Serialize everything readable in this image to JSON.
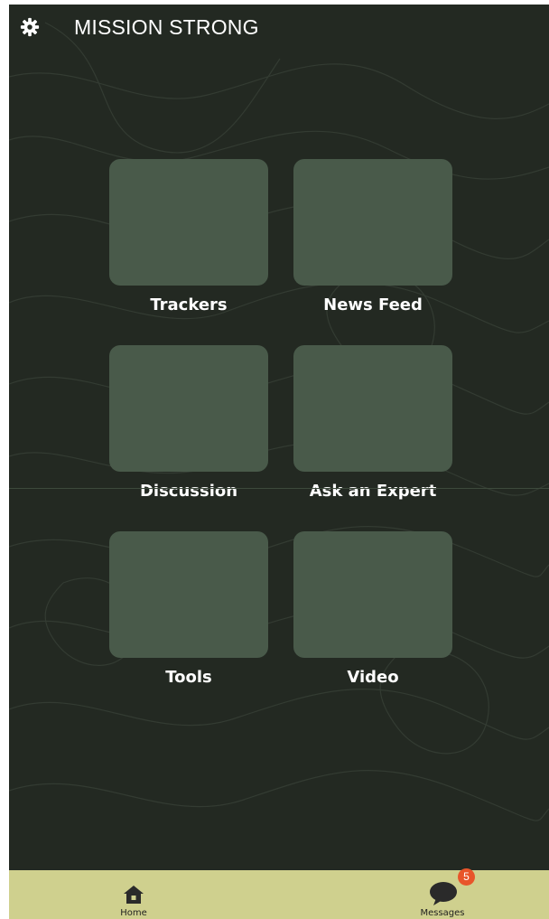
{
  "header": {
    "title": "MISSION STRONG",
    "settings_icon": "gear-icon"
  },
  "tiles": [
    {
      "label": "Trackers"
    },
    {
      "label": "News Feed"
    },
    {
      "label": "Discussion"
    },
    {
      "label": "Ask an Expert"
    },
    {
      "label": "Tools"
    },
    {
      "label": "Video"
    }
  ],
  "bottom_nav": {
    "home": {
      "label": "Home",
      "icon": "home-icon"
    },
    "messages": {
      "label": "Messages",
      "icon": "chat-bubble-icon",
      "badge": "5"
    }
  },
  "colors": {
    "background": "#232922",
    "tile": "#495a4a",
    "nav_bar": "#cfd08e",
    "badge": "#e8552a"
  }
}
